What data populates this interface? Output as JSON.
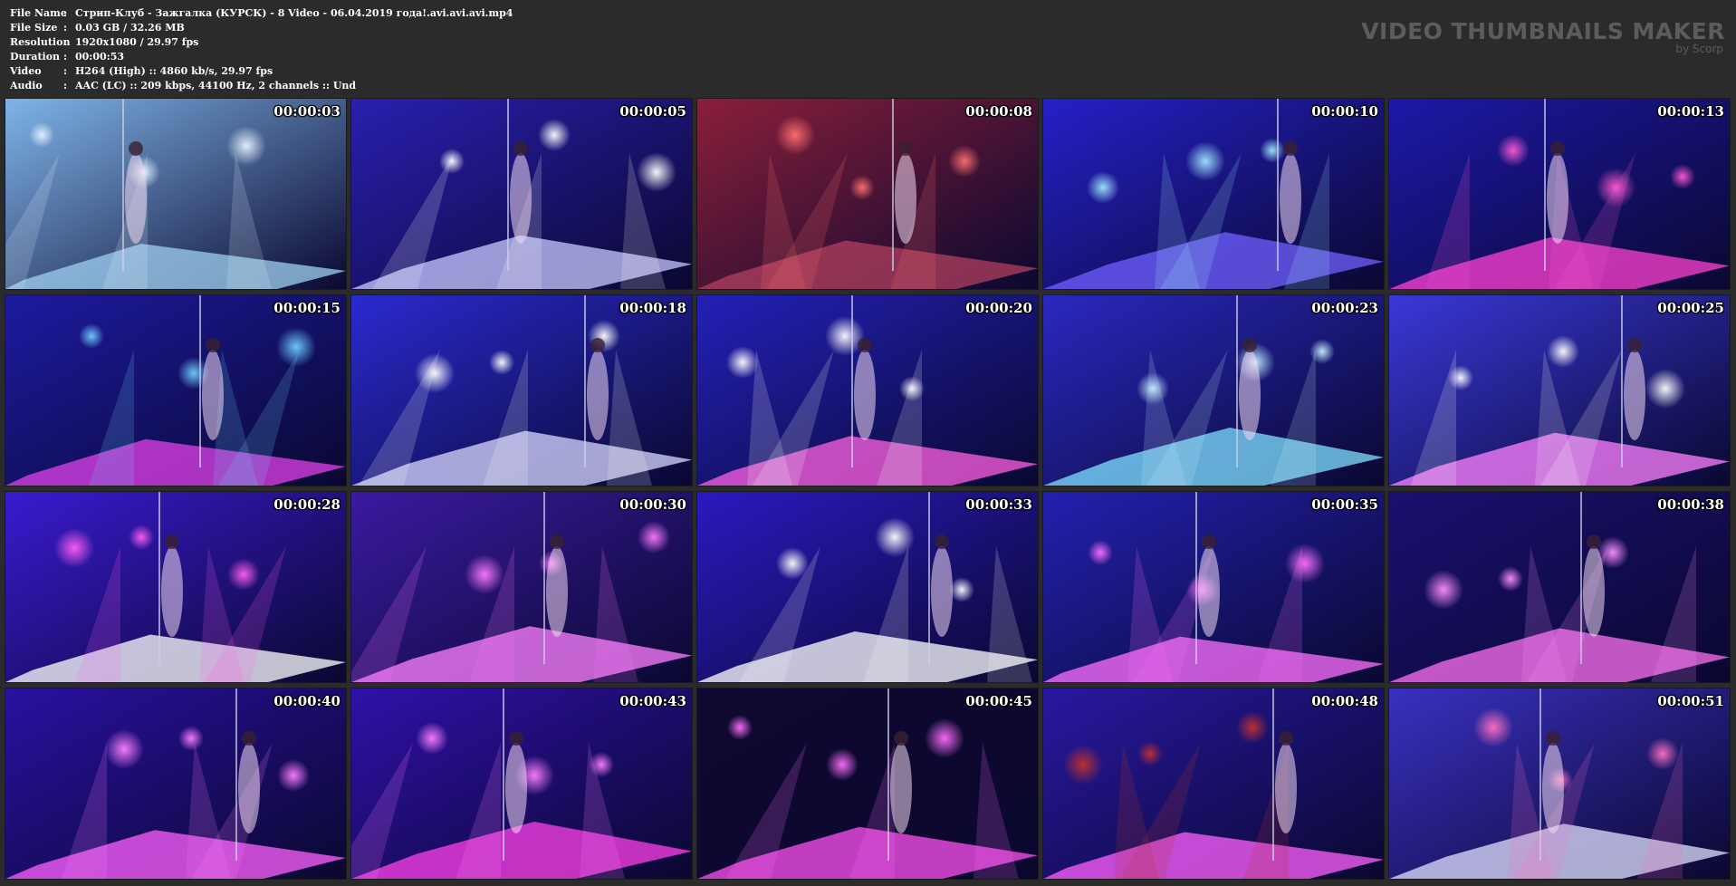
{
  "info": {
    "rows": [
      {
        "key": "File Name",
        "value": "Стрип-Клуб - Зажгалка (КУРСК) - 8 Video - 06.04.2019 года!.avi.avi.avi.mp4"
      },
      {
        "key": "File Size",
        "value": "0.03 GB  / 32.26 MB"
      },
      {
        "key": "Resolution",
        "value": "1920x1080 / 29.97 fps"
      },
      {
        "key": "Duration",
        "value": "00:00:53"
      },
      {
        "key": "Video",
        "value": "H264 (High) :: 4860 kb/s, 29.97 fps"
      },
      {
        "key": "Audio",
        "value": "AAC (LC) :: 209 kbps, 44100 Hz, 2 channels :: Und"
      }
    ],
    "separator": ":"
  },
  "brand": {
    "title": "VIDEO THUMBNAILS MAKER",
    "subtitle": "by Scorp"
  },
  "thumbnails": [
    {
      "time": "00:00:03",
      "bg": "#7fb4e8",
      "accent": "#e6f3ff",
      "floor": "#9fd0f0"
    },
    {
      "time": "00:00:05",
      "bg": "#2a1fb0",
      "accent": "#ffffff",
      "floor": "#c8c8ff"
    },
    {
      "time": "00:00:08",
      "bg": "#8a1f3a",
      "accent": "#ff6f6f",
      "floor": "#b04060"
    },
    {
      "time": "00:00:10",
      "bg": "#2620c8",
      "accent": "#9fe8ff",
      "floor": "#7060ff"
    },
    {
      "time": "00:00:13",
      "bg": "#1e18a8",
      "accent": "#ff5ad0",
      "floor": "#ff40d0"
    },
    {
      "time": "00:00:15",
      "bg": "#1d1aa0",
      "accent": "#6fd0ff",
      "floor": "#e040e8"
    },
    {
      "time": "00:00:18",
      "bg": "#2a2ad0",
      "accent": "#ffffff",
      "floor": "#d8d8ff"
    },
    {
      "time": "00:00:20",
      "bg": "#2420b8",
      "accent": "#ffffff",
      "floor": "#ff60e0"
    },
    {
      "time": "00:00:23",
      "bg": "#2a28c0",
      "accent": "#c8f0ff",
      "floor": "#7fe0ff"
    },
    {
      "time": "00:00:25",
      "bg": "#3a38d8",
      "accent": "#ffffff",
      "floor": "#ff80ff"
    },
    {
      "time": "00:00:28",
      "bg": "#3a1ad0",
      "accent": "#ff60f0",
      "floor": "#ffffff"
    },
    {
      "time": "00:00:30",
      "bg": "#3a1aa0",
      "accent": "#ff7aff",
      "floor": "#ff80ff"
    },
    {
      "time": "00:00:33",
      "bg": "#2a1ac0",
      "accent": "#ffffff",
      "floor": "#ffffff"
    },
    {
      "time": "00:00:35",
      "bg": "#2420b0",
      "accent": "#ff70ff",
      "floor": "#ff70ff"
    },
    {
      "time": "00:00:38",
      "bg": "#1a1070",
      "accent": "#ff90ff",
      "floor": "#ff70f0"
    },
    {
      "time": "00:00:40",
      "bg": "#2a10a0",
      "accent": "#ff80ff",
      "floor": "#ff60ff"
    },
    {
      "time": "00:00:43",
      "bg": "#3010a8",
      "accent": "#ff80ff",
      "floor": "#ff40e8"
    },
    {
      "time": "00:00:45",
      "bg": "#100830",
      "accent": "#ff70ff",
      "floor": "#ff50f0"
    },
    {
      "time": "00:00:48",
      "bg": "#2818a0",
      "accent": "#c03030",
      "floor": "#ff60ff"
    },
    {
      "time": "00:00:51",
      "bg": "#3a30c0",
      "accent": "#ff70c0",
      "floor": "#e0e0ff"
    }
  ]
}
